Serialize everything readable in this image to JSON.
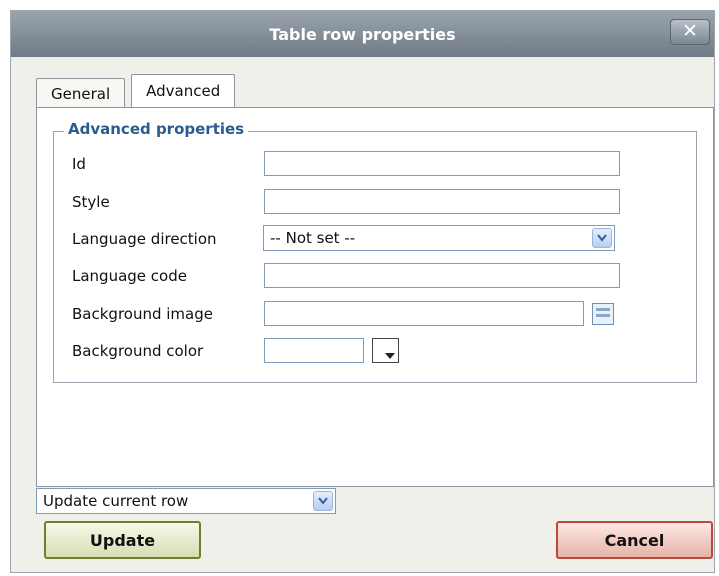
{
  "dialog": {
    "title": "Table row properties",
    "close_label": "✕"
  },
  "tabs": [
    {
      "label": "General"
    },
    {
      "label": "Advanced"
    }
  ],
  "fieldset": {
    "legend": "Advanced properties",
    "rows": [
      {
        "label": "Id",
        "value": ""
      },
      {
        "label": "Style",
        "value": ""
      },
      {
        "label": "Language direction",
        "value": "-- Not set --"
      },
      {
        "label": "Language code",
        "value": ""
      },
      {
        "label": "Background image",
        "value": ""
      },
      {
        "label": "Background color",
        "value": ""
      }
    ]
  },
  "action_select": {
    "value": "Update current row"
  },
  "buttons": {
    "update": "Update",
    "cancel": "Cancel"
  },
  "icons": {
    "dropdown": "chevron-down-icon",
    "browse": "browse-icon",
    "color": "color-picker-icon"
  },
  "colors": {
    "legend": "#2b5c8f",
    "update_border": "#6c7f2f",
    "cancel_border": "#b84a3c"
  }
}
